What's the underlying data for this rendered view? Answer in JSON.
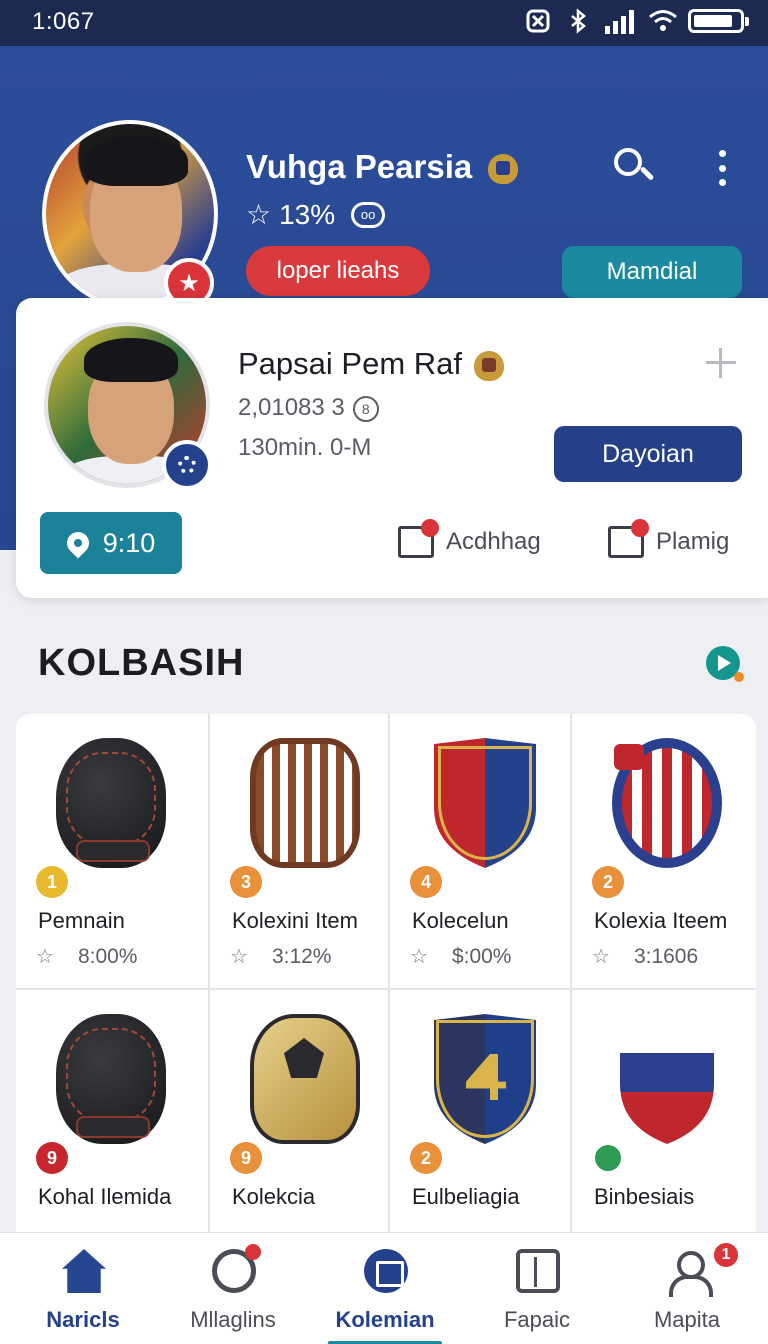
{
  "status_bar": {
    "time": "1:067"
  },
  "header": {
    "name": "Vuhga Pearsia",
    "rating": "13%",
    "rating_extra": "oo",
    "red_button": "loper lieahs",
    "teal_button": "Mamdial"
  },
  "profile_card": {
    "name": "Papsai Pem Raf",
    "stat1": "2,01083 3",
    "stat1_icon": "8",
    "stat2": "130min. 0-M",
    "action_button": "Dayoian",
    "pin_button": "9:10",
    "actions": [
      {
        "label": "Acdhhag",
        "icon": "edit-icon"
      },
      {
        "label": "Plamig",
        "icon": "check-icon"
      }
    ]
  },
  "section": {
    "title": "KOLBASIH"
  },
  "items": [
    {
      "rank": "1",
      "rank_color": "#e8b92e",
      "title": "Pemnain",
      "value": "8:00%"
    },
    {
      "rank": "3",
      "rank_color": "#e8913a",
      "title": "Kolexini Item",
      "value": "3:12%"
    },
    {
      "rank": "4",
      "rank_color": "#e8913a",
      "title": "Kolecelun",
      "value": "$:00%"
    },
    {
      "rank": "2",
      "rank_color": "#e8913a",
      "title": "Kolexia Iteem",
      "value": "3:1606"
    },
    {
      "rank": "9",
      "rank_color": "#c7262c",
      "title": "Kohal Ilemida",
      "value": ""
    },
    {
      "rank": "9",
      "rank_color": "#e8913a",
      "title": "Kolekcia",
      "value": ""
    },
    {
      "rank": "2",
      "rank_color": "#e8913a",
      "title": "Eulbeliagia",
      "value": ""
    },
    {
      "rank": "",
      "rank_color": "#2e9b55",
      "title": "Binbesiais",
      "value": ""
    }
  ],
  "bottom_nav": [
    {
      "label": "Naricls"
    },
    {
      "label": "Mllaglins"
    },
    {
      "label": "Kolemian"
    },
    {
      "label": "Fapaic"
    },
    {
      "label": "Mapita",
      "badge": "1"
    }
  ]
}
